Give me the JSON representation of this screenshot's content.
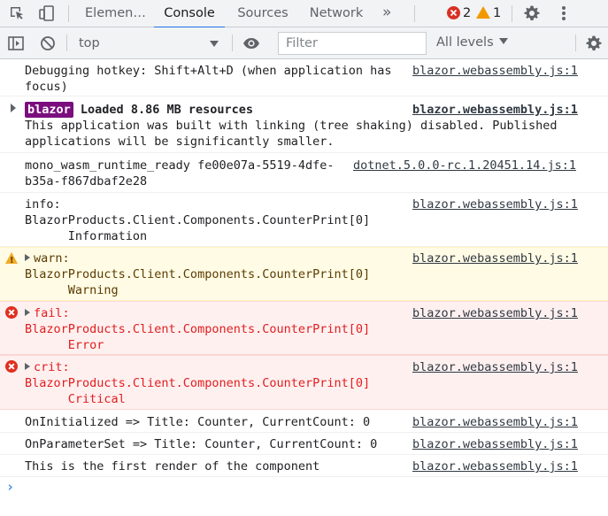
{
  "tabbar": {
    "tabs": [
      {
        "label": "Elemen…",
        "active": false
      },
      {
        "label": "Console",
        "active": true
      },
      {
        "label": "Sources",
        "active": false
      },
      {
        "label": "Network",
        "active": false
      }
    ],
    "more_tabs": "»",
    "error_count": "2",
    "warning_count": "1",
    "icons": [
      "inspect-element-icon",
      "device-toolbar-icon",
      "more-tabs-icon",
      "settings-gear-icon",
      "kebab-menu-icon"
    ]
  },
  "toolbar": {
    "icons": [
      "sidebar-toggle-icon",
      "clear-console-icon",
      "eye-icon",
      "console-settings-gear-icon"
    ],
    "context": "top",
    "filter_placeholder": "Filter",
    "filter_value": "",
    "levels": "All levels"
  },
  "colors": {
    "accent": "#1a73e8",
    "error": "#e21e1e",
    "warning": "#f2ab26",
    "blazor_badge": "#7b0e7e"
  },
  "messages": [
    {
      "level": "info",
      "lines": [
        "Debugging hotkey: Shift+Alt+D (when application has",
        "focus)"
      ],
      "source": "blazor.webassembly.js:1"
    },
    {
      "level": "info",
      "expandable": true,
      "badge": "blazor",
      "title": "Loaded 8.86 MB resources",
      "lines": [
        "This application was built with linking (tree shaking) disabled. Published",
        "applications will be significantly smaller."
      ],
      "source": "blazor.webassembly.js:1"
    },
    {
      "level": "info",
      "lines": [
        "mono_wasm_runtime_ready fe00e07a-5519-4dfe-",
        "b35a-f867dbaf2e28"
      ],
      "source": "dotnet.5.0.0-rc.1.20451.14.js:1"
    },
    {
      "level": "info",
      "lines": [
        "info:",
        "BlazorProducts.Client.Components.CounterPrint[0]",
        "      Information"
      ],
      "source": "blazor.webassembly.js:1"
    },
    {
      "level": "warning",
      "prefix": "warn:",
      "lines": [
        "BlazorProducts.Client.Components.CounterPrint[0]",
        "      Warning"
      ],
      "source": "blazor.webassembly.js:1"
    },
    {
      "level": "error",
      "prefix": "fail:",
      "lines": [
        "BlazorProducts.Client.Components.CounterPrint[0]",
        "      Error"
      ],
      "source": "blazor.webassembly.js:1"
    },
    {
      "level": "error",
      "prefix": "crit:",
      "lines": [
        "BlazorProducts.Client.Components.CounterPrint[0]",
        "      Critical"
      ],
      "source": "blazor.webassembly.js:1"
    },
    {
      "level": "info",
      "lines": [
        "OnInitialized => Title: Counter, CurrentCount: 0"
      ],
      "source": "blazor.webassembly.js:1"
    },
    {
      "level": "info",
      "lines": [
        "OnParameterSet => Title: Counter, CurrentCount: 0"
      ],
      "source": "blazor.webassembly.js:1"
    },
    {
      "level": "info",
      "lines": [
        "This is the first render of the component"
      ],
      "source": "blazor.webassembly.js:1"
    }
  ],
  "prompt": "›"
}
